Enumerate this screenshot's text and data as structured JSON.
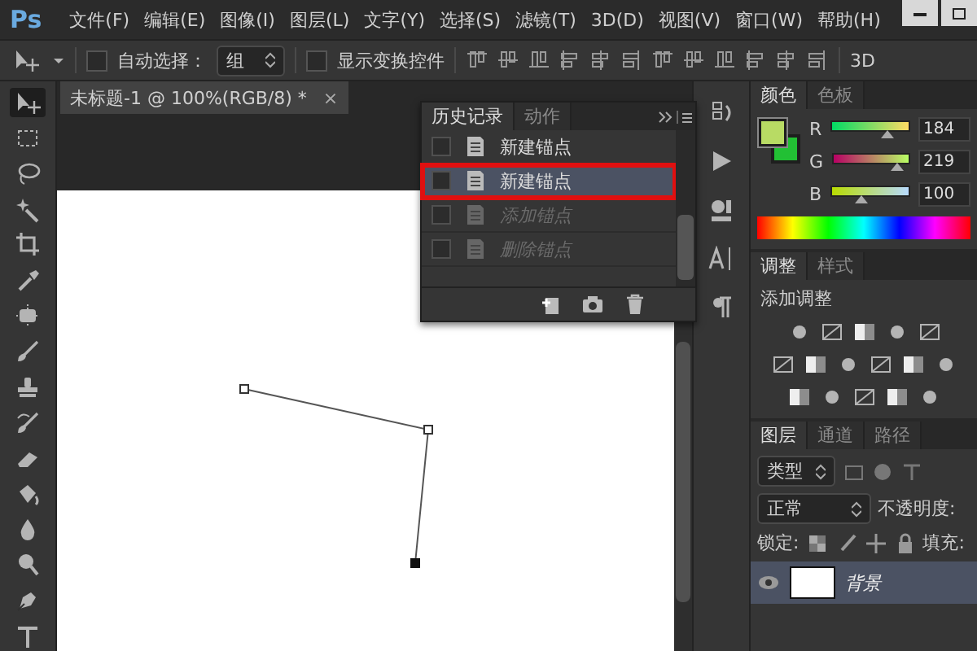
{
  "app": {
    "logo": "Ps"
  },
  "menu": [
    "文件(F)",
    "编辑(E)",
    "图像(I)",
    "图层(L)",
    "文字(Y)",
    "选择(S)",
    "滤镜(T)",
    "3D(D)",
    "视图(V)",
    "窗口(W)",
    "帮助(H)"
  ],
  "options_bar": {
    "auto_select": {
      "label": "自动选择：",
      "checked": false
    },
    "auto_select_mode": "组",
    "show_transform": {
      "label": "显示变换控件",
      "checked": false
    },
    "mode_label": "3D"
  },
  "document_tab": {
    "title": "未标题-1 @ 100%(RGB/8) *",
    "close": "×"
  },
  "history_panel": {
    "tabs": [
      {
        "label": "历史记录",
        "selected": true
      },
      {
        "label": "动作",
        "selected": false
      }
    ],
    "items": [
      {
        "label": "新建锚点",
        "selected": false,
        "disabled": false,
        "highlighted": false
      },
      {
        "label": "新建锚点",
        "selected": true,
        "disabled": false,
        "highlighted": true
      },
      {
        "label": "添加锚点",
        "selected": false,
        "disabled": true,
        "highlighted": false
      },
      {
        "label": "删除锚点",
        "selected": false,
        "disabled": true,
        "highlighted": false
      }
    ]
  },
  "color_panel": {
    "tabs": [
      {
        "label": "颜色",
        "selected": true
      },
      {
        "label": "色板",
        "selected": false
      }
    ],
    "channels": [
      {
        "name": "R",
        "level": 0.72,
        "value": "184"
      },
      {
        "name": "G",
        "level": 0.86,
        "value": "219"
      },
      {
        "name": "B",
        "level": 0.39,
        "value": "100"
      }
    ]
  },
  "adjustments_panel": {
    "tabs": [
      {
        "label": "调整",
        "selected": true
      },
      {
        "label": "样式",
        "selected": false
      }
    ],
    "title": "添加调整"
  },
  "layers_panel": {
    "tabs": [
      {
        "label": "图层",
        "selected": true
      },
      {
        "label": "通道",
        "selected": false
      },
      {
        "label": "路径",
        "selected": false
      }
    ],
    "filter": "类型",
    "blend_mode": "正常",
    "opacity_label": "不透明度:",
    "lock_label": "锁定:",
    "fill_label": "填充:",
    "layers": [
      {
        "name": "背景",
        "selected": true,
        "visible": true
      }
    ]
  }
}
